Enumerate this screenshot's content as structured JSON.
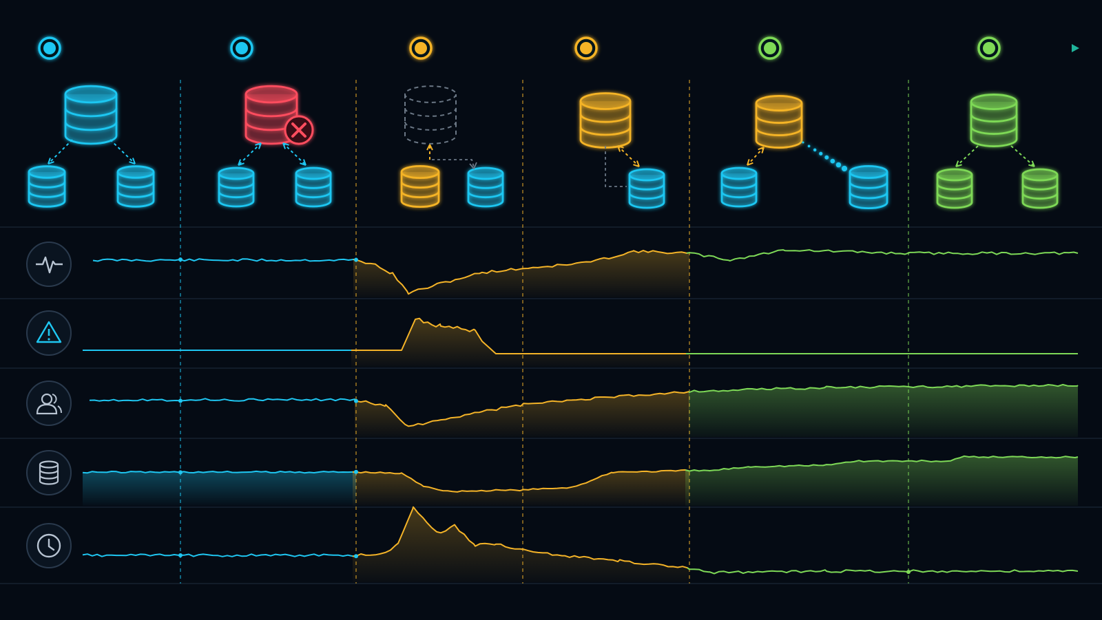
{
  "colors": {
    "background": "#050b14",
    "healthy": "#1fc7f2",
    "failure": "#ff4d5e",
    "degraded": "#f5b428",
    "recovered": "#7ed957",
    "divider": "#1a2636",
    "icon_ring": "#2a3a4d",
    "icon_stroke": "#b8c4d2",
    "ghost": "#6b7785"
  },
  "timeline": {
    "stages": [
      {
        "id": "stage-1",
        "status": "healthy"
      },
      {
        "id": "stage-2",
        "status": "healthy"
      },
      {
        "id": "stage-3",
        "status": "degraded"
      },
      {
        "id": "stage-4",
        "status": "degraded"
      },
      {
        "id": "stage-5",
        "status": "recovered"
      },
      {
        "id": "stage-6",
        "status": "recovered"
      }
    ]
  },
  "topologies": [
    {
      "id": "topology-1",
      "state": "healthy-primary-two-replicas",
      "primary_status": "healthy"
    },
    {
      "id": "topology-2",
      "state": "primary-failed",
      "primary_status": "failure",
      "badge_icon": "x-circle-icon"
    },
    {
      "id": "topology-3",
      "state": "replica-promoted",
      "primary_status": "missing"
    },
    {
      "id": "topology-4",
      "state": "new-primary-one-replica",
      "primary_status": "degraded"
    },
    {
      "id": "topology-5",
      "state": "replica-resync",
      "primary_status": "degraded"
    },
    {
      "id": "topology-6",
      "state": "recovered-primary-two-replicas",
      "primary_status": "recovered"
    }
  ],
  "metric_rows": [
    {
      "id": "throughput",
      "icon": "heartbeat-icon"
    },
    {
      "id": "errors",
      "icon": "warning-triangle-icon"
    },
    {
      "id": "active-users",
      "icon": "users-icon"
    },
    {
      "id": "storage",
      "icon": "database-icon"
    },
    {
      "id": "latency",
      "icon": "clock-icon"
    }
  ]
}
